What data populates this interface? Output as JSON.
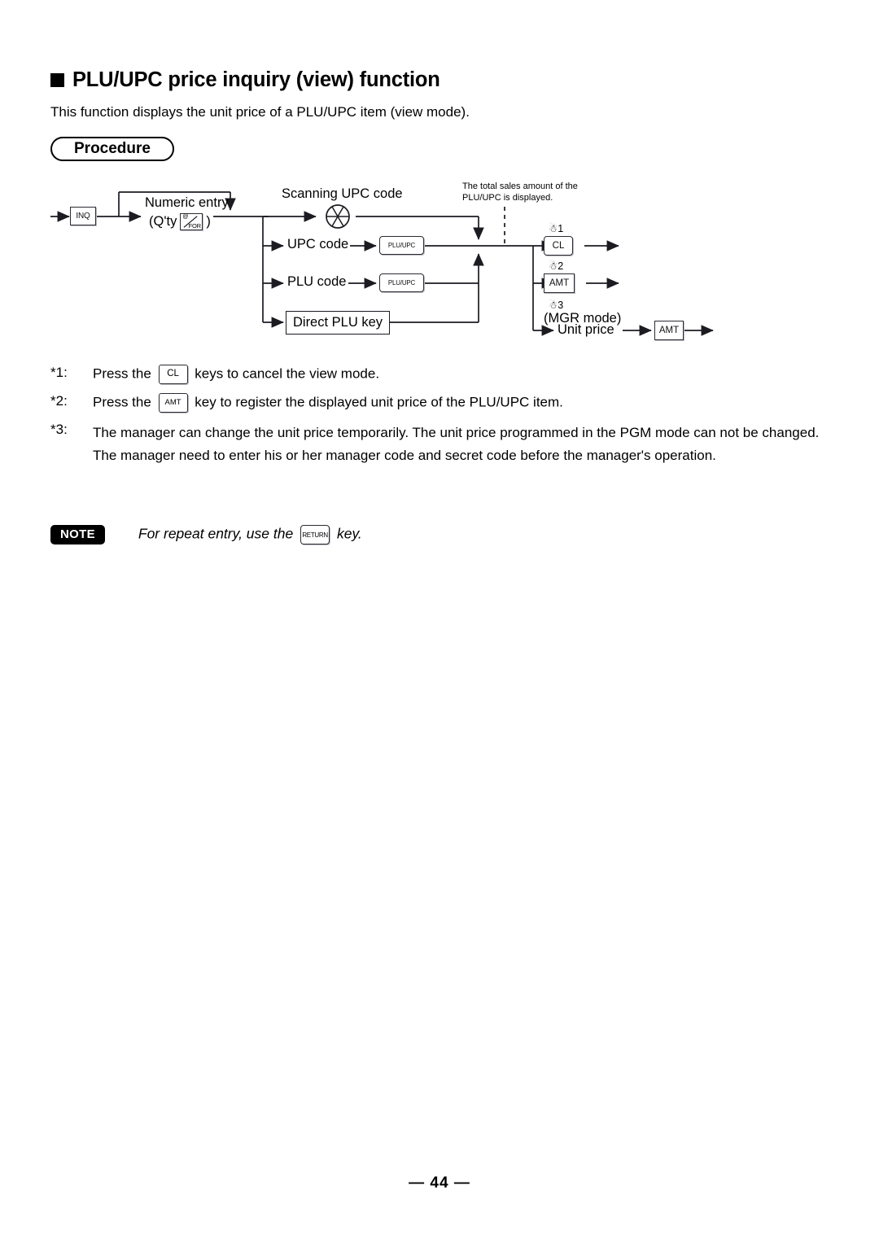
{
  "document": {
    "heading": "PLU/UPC price inquiry (view) function",
    "intro": "This function displays the unit price of a PLU/UPC item (view mode).",
    "section_label": "Procedure",
    "page_number": "— 44 —"
  },
  "flowchart": {
    "start_key": "INQ",
    "numeric_entry_line1": "Numeric entry",
    "numeric_entry_qty_prefix": "(Q'ty",
    "numeric_entry_qty_suffix": ")",
    "at_for_key_top": "@",
    "at_for_key_bottom": "FOR",
    "scanning_label": "Scanning UPC code",
    "scanner_icon": "scanner-wheel-icon",
    "branches": [
      {
        "label": "UPC code",
        "key": "PLU/UPC"
      },
      {
        "label": "PLU code",
        "key": "PLU/UPC"
      }
    ],
    "direct_plu_box": "Direct PLU key",
    "callout_line1": "The total sales amount of the",
    "callout_line2": "PLU/UPC is displayed.",
    "outputs": [
      {
        "mark": "☃1",
        "key": "CL"
      },
      {
        "mark": "☃2",
        "key": "AMT"
      }
    ],
    "mgr": {
      "mark": "☃3",
      "mode_label": "(MGR mode)",
      "unit_price_label": "Unit price",
      "key": "AMT"
    }
  },
  "footnotes": [
    {
      "mark": "*1:",
      "before": "Press the",
      "key": "CL",
      "after": "keys to cancel the view mode."
    },
    {
      "mark": "*2:",
      "before": "Press the",
      "key": "AMT",
      "after": "key to register the displayed unit price of the PLU/UPC item."
    },
    {
      "mark": "*3:",
      "text": "The manager can change the unit price temporarily. The unit price programmed in the PGM mode can not be changed. The manager need to enter his or her manager code and secret code before the manager's operation."
    }
  ],
  "note": {
    "badge": "NOTE",
    "before": "For repeat entry, use the",
    "key": "RETURN",
    "after": "key."
  }
}
